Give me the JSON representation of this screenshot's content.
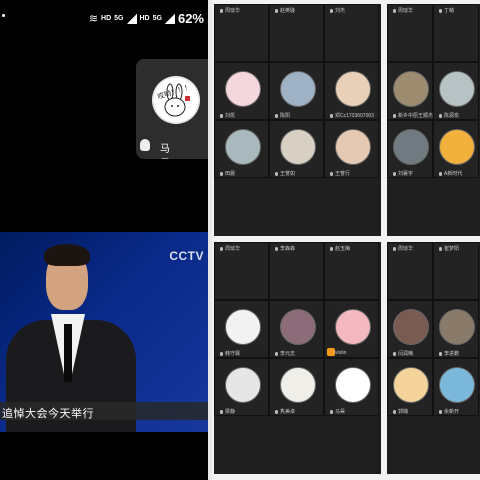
{
  "status_bar": {
    "hd1": "HD",
    "five_g1": "5G",
    "hd2": "HD",
    "five_g2": "5G",
    "battery": "62%"
  },
  "self_tile": {
    "name": "马昊",
    "avatar_caption": "哎哟！！！"
  },
  "tv": {
    "logo": "CCTV",
    "subtitle": "追悼大会今天举行"
  },
  "panels": [
    {
      "participants": [
        {
          "name": "周琰华",
          "avatar_color": "#2d2d2d"
        },
        {
          "name": "赵英璇",
          "avatar_color": "#2d2d2d"
        },
        {
          "name": "刘杰",
          "avatar_color": "#2d2d2d"
        },
        {
          "name": "刘凯",
          "avatar_color": "#f4d7dc"
        },
        {
          "name": "陈阳",
          "avatar_color": "#9fb1c4"
        },
        {
          "name": "邓Cc1703607003",
          "avatar_color": "#e8d1b8"
        },
        {
          "name": "田晨",
          "avatar_color": "#a8b8bd"
        },
        {
          "name": "王誉如",
          "avatar_color": "#d9d0c4"
        },
        {
          "name": "王誉行",
          "avatar_color": "#e5c9b2"
        }
      ]
    },
    {
      "participants": [
        {
          "name": "周琰华",
          "avatar_color": "#2d2d2d"
        },
        {
          "name": "丁萌",
          "avatar_color": "#2d2d2d"
        },
        {
          "name": "新乡中原王顺杰",
          "avatar_color": "#9d8c70"
        },
        {
          "name": "陈源泉",
          "avatar_color": "#b6c2c3"
        },
        {
          "name": "刘襄宇",
          "avatar_color": "#6f7b80"
        },
        {
          "name": "A新时代",
          "avatar_color": "#f2b13c"
        }
      ]
    },
    {
      "participants": [
        {
          "name": "周琰华",
          "avatar_color": "#2d2d2d"
        },
        {
          "name": "李森森",
          "avatar_color": "#2d2d2d"
        },
        {
          "name": "赵玉梅",
          "avatar_color": "#2d2d2d"
        },
        {
          "name": "韩守霖",
          "avatar_color": "#f2f2f2"
        },
        {
          "name": "李元志",
          "avatar_color": "#8b6c78"
        },
        {
          "name": "violin",
          "avatar_color": "#f4b9c0"
        },
        {
          "name": "梁静",
          "avatar_color": "#e6e6e6"
        },
        {
          "name": "隽美卓",
          "avatar_color": "#f0eee8"
        },
        {
          "name": "马昊",
          "avatar_color": "#ffffff"
        }
      ]
    },
    {
      "participants": [
        {
          "name": "周琰华",
          "avatar_color": "#2d2d2d"
        },
        {
          "name": "崔梦阳",
          "avatar_color": "#2d2d2d"
        },
        {
          "name": "闫润楠",
          "avatar_color": "#7a5b52"
        },
        {
          "name": "李进鹏",
          "avatar_color": "#8a7a6a"
        },
        {
          "name": "郭璐",
          "avatar_color": "#f4d49b"
        },
        {
          "name": "余新开",
          "avatar_color": "#7bb8dc"
        }
      ]
    }
  ]
}
